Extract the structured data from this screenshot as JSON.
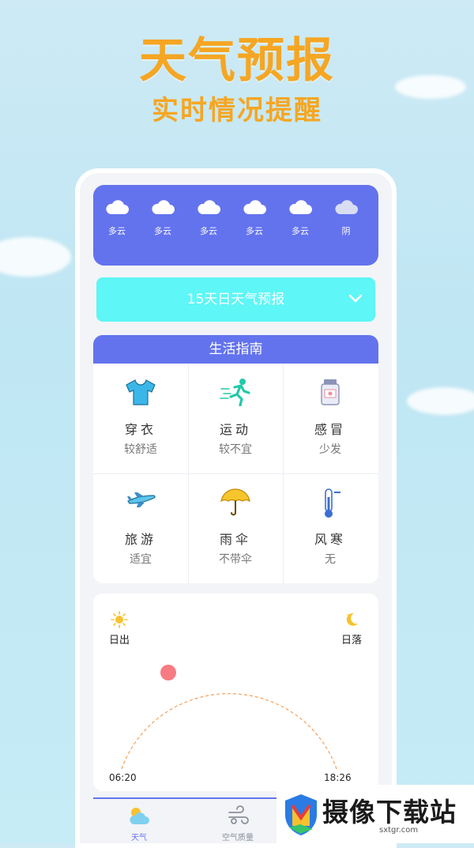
{
  "hero": {
    "title": "天气预报",
    "subtitle": "实时情况提醒"
  },
  "forecast_days": [
    {
      "label": "多云",
      "icon": "cloud-icon"
    },
    {
      "label": "多云",
      "icon": "cloud-icon"
    },
    {
      "label": "多云",
      "icon": "cloud-icon"
    },
    {
      "label": "多云",
      "icon": "cloud-icon"
    },
    {
      "label": "多云",
      "icon": "cloud-icon"
    },
    {
      "label": "阴",
      "icon": "overcast-icon"
    }
  ],
  "forecast_button": {
    "label": "15天日天气预报"
  },
  "guide": {
    "title": "生活指南",
    "items": [
      {
        "name": "穿衣",
        "value": "较舒适",
        "icon": "shirt-icon"
      },
      {
        "name": "运动",
        "value": "较不宜",
        "icon": "running-icon"
      },
      {
        "name": "感冒",
        "value": "少发",
        "icon": "medicine-icon"
      },
      {
        "name": "旅游",
        "value": "适宜",
        "icon": "airplane-icon"
      },
      {
        "name": "雨伞",
        "value": "不带伞",
        "icon": "umbrella-icon"
      },
      {
        "name": "风寒",
        "value": "无",
        "icon": "thermometer-icon"
      }
    ]
  },
  "sun": {
    "sunrise_label": "日出",
    "sunset_label": "日落",
    "sunrise_time": "06:20",
    "sunset_time": "18:26"
  },
  "tabs": [
    {
      "label": "天气",
      "icon": "weather-icon",
      "active": true
    },
    {
      "label": "空气质量",
      "icon": "air-quality-icon",
      "active": false
    }
  ],
  "watermark": {
    "text": "摄像下载站",
    "url": "sxtgr.com"
  },
  "colors": {
    "accent": "#6373ee",
    "cyan": "#5ef6f6",
    "orange": "#f5a623",
    "sun_dot": "#f77b82"
  }
}
